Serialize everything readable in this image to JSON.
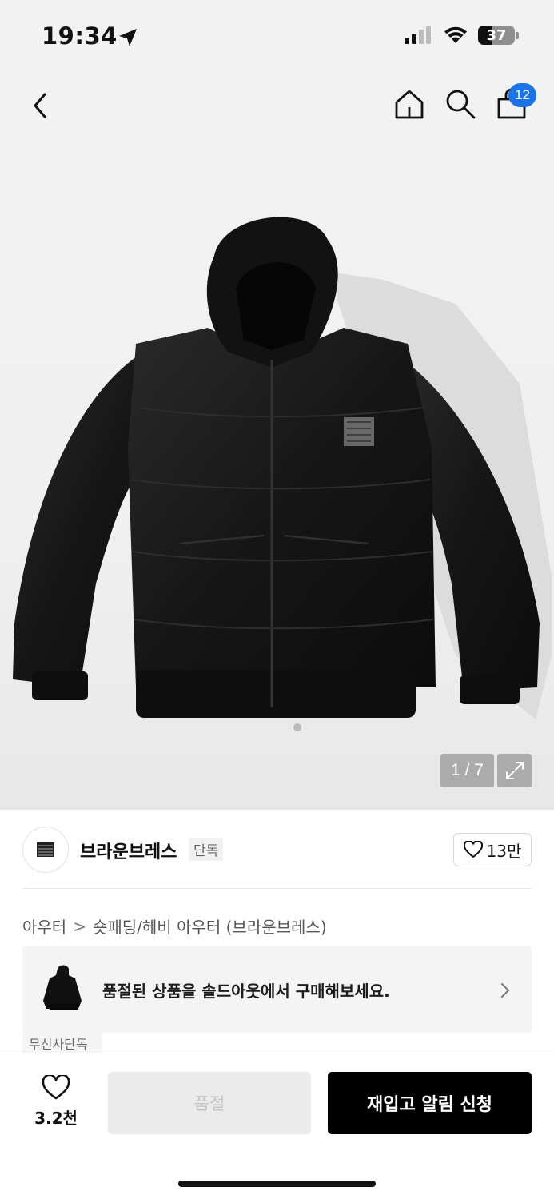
{
  "status_bar": {
    "time": "19:34",
    "battery": "37",
    "battery_level": 0.37
  },
  "header": {
    "cart_count": "12"
  },
  "gallery": {
    "counter": "1 / 7"
  },
  "brand": {
    "name": "브라운브레스",
    "tag": "단독",
    "likes": "13만"
  },
  "breadcrumb": {
    "category": "아우터",
    "separator": ">",
    "subcategory": "숏패딩/헤비 아우터 (브라운브레스)"
  },
  "banner": {
    "text": "품절된 상품을 솔드아웃에서 구매해보세요.",
    "badge": "무신사단독"
  },
  "actions": {
    "wish_count": "3.2천",
    "soldout_label": "품절",
    "restock_label": "재입고 알림 신청"
  },
  "icons": [
    "location-arrow-icon",
    "cellular-signal-icon",
    "wifi-icon",
    "battery-icon",
    "back-icon",
    "home-icon",
    "search-icon",
    "shopping-bag-icon",
    "expand-icon",
    "heart-icon",
    "chevron-right-icon"
  ],
  "colors": {
    "accent_badge": "#1a73e8",
    "primary_button": "#000000",
    "disabled_button": "#ebebeb"
  }
}
